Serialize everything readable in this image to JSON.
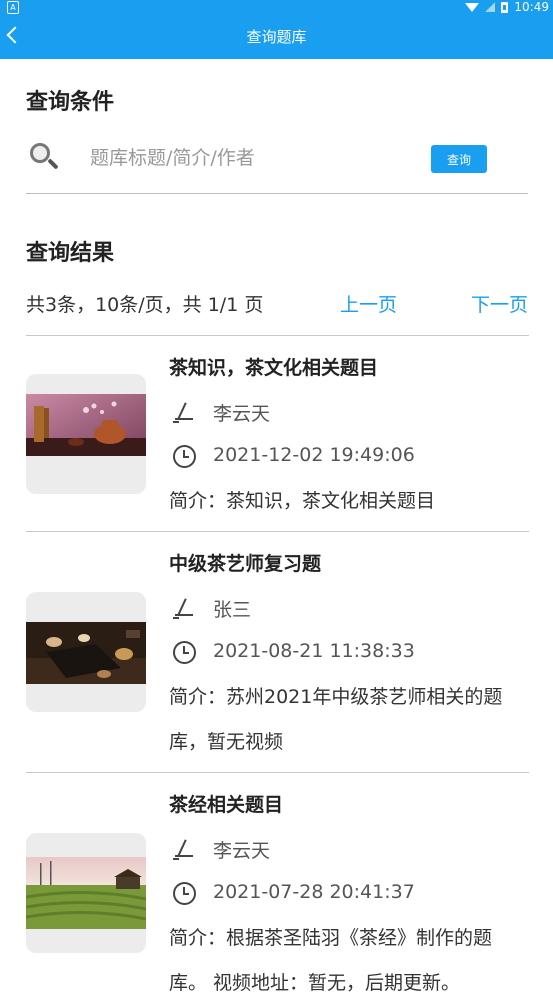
{
  "status_bar": {
    "time": "10:49",
    "left_icon": "A"
  },
  "header": {
    "title": "查询题库"
  },
  "search_section": {
    "title": "查询条件",
    "placeholder": "题库标题/简介/作者",
    "button_label": "查询"
  },
  "results_section": {
    "title": "查询结果",
    "page_info": "共3条，10条/页，共 1/1 页",
    "prev_label": "上一页",
    "next_label": "下一页"
  },
  "results": [
    {
      "title": "茶知识，茶文化相关题目",
      "author": "李云天",
      "time": "2021-12-02 19:49:06",
      "description": "简介：茶知识，茶文化相关题目"
    },
    {
      "title": "中级茶艺师复习题",
      "author": "张三",
      "time": "2021-08-21 11:38:33",
      "description": "简介：苏州2021年中级茶艺师相关的题库，暂无视频"
    },
    {
      "title": "茶经相关题目",
      "author": "李云天",
      "time": "2021-07-28 20:41:37",
      "description": "简介：根据茶圣陆羽《茶经》制作的题库。 视频地址：暂无，后期更新。"
    }
  ],
  "colors": {
    "accent": "#1a9ff0",
    "divider": "#c7c7c7"
  }
}
